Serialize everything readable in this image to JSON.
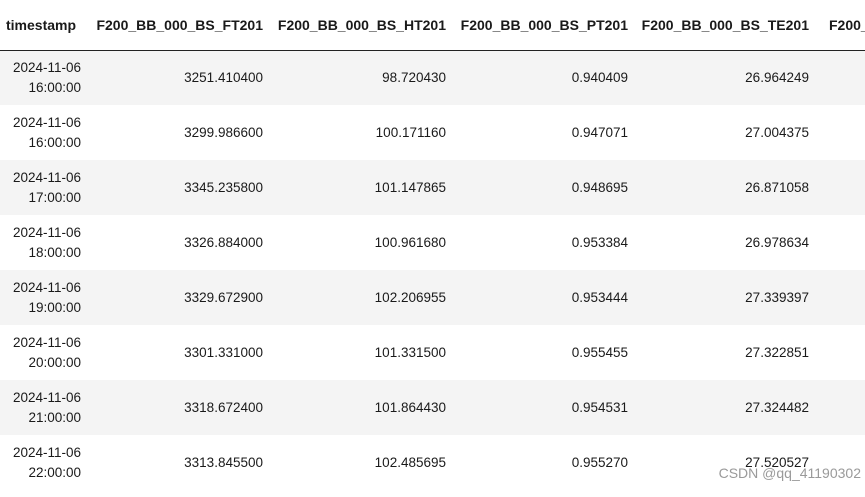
{
  "table": {
    "columns": [
      "timestamp",
      "F200_BB_000_BS_FT201",
      "F200_BB_000_BS_HT201",
      "F200_BB_000_BS_PT201",
      "F200_BB_000_BS_TE201",
      "F200_"
    ],
    "rows": [
      {
        "date": "2024-11-06",
        "time": "16:00:00",
        "ft201": "3251.410400",
        "ht201": "98.720430",
        "pt201": "0.940409",
        "te201": "26.964249"
      },
      {
        "date": "2024-11-06",
        "time": "16:00:00",
        "ft201": "3299.986600",
        "ht201": "100.171160",
        "pt201": "0.947071",
        "te201": "27.004375"
      },
      {
        "date": "2024-11-06",
        "time": "17:00:00",
        "ft201": "3345.235800",
        "ht201": "101.147865",
        "pt201": "0.948695",
        "te201": "26.871058"
      },
      {
        "date": "2024-11-06",
        "time": "18:00:00",
        "ft201": "3326.884000",
        "ht201": "100.961680",
        "pt201": "0.953384",
        "te201": "26.978634"
      },
      {
        "date": "2024-11-06",
        "time": "19:00:00",
        "ft201": "3329.672900",
        "ht201": "102.206955",
        "pt201": "0.953444",
        "te201": "27.339397"
      },
      {
        "date": "2024-11-06",
        "time": "20:00:00",
        "ft201": "3301.331000",
        "ht201": "101.331500",
        "pt201": "0.955455",
        "te201": "27.322851"
      },
      {
        "date": "2024-11-06",
        "time": "21:00:00",
        "ft201": "3318.672400",
        "ht201": "101.864430",
        "pt201": "0.954531",
        "te201": "27.324482"
      },
      {
        "date": "2024-11-06",
        "time": "22:00:00",
        "ft201": "3313.845500",
        "ht201": "102.485695",
        "pt201": "0.955270",
        "te201": "27.520527"
      }
    ]
  },
  "watermark": "CSDN @qq_41190302"
}
